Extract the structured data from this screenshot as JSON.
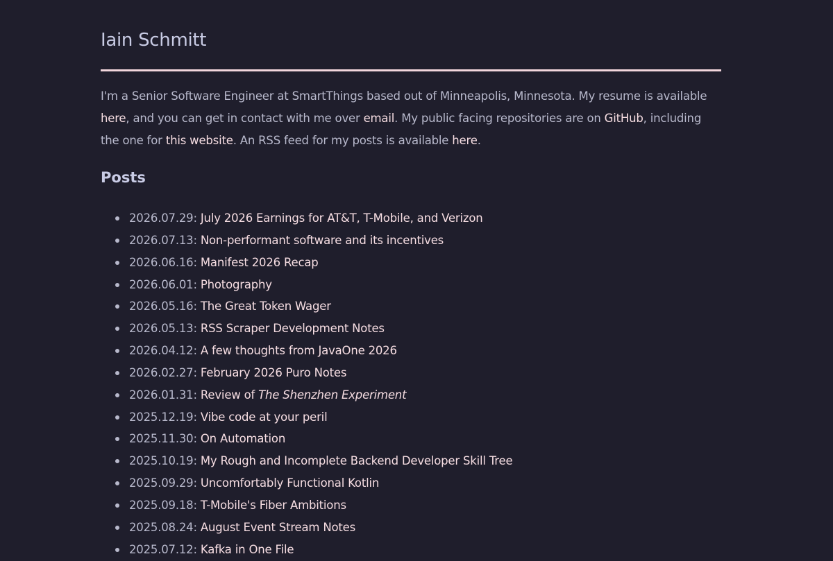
{
  "header": {
    "title": "Iain Schmitt"
  },
  "intro": {
    "t1": "I'm a Senior Software Engineer at SmartThings based out of Minneapolis, Minnesota. My resume is available ",
    "resume_link": "here",
    "t2": ", and you can get in contact with me over ",
    "email_link": "email",
    "t3": ". My public facing repositories are on ",
    "github_link": "GitHub",
    "t4": ", including the one for ",
    "website_link": "this website",
    "t5": ". An RSS feed for my posts is available ",
    "rss_link": "here",
    "t6": "."
  },
  "posts": {
    "heading": "Posts",
    "items": [
      {
        "date": "2026.07.29",
        "title": "July 2026 Earnings for AT&T, T-Mobile, and Verizon"
      },
      {
        "date": "2026.07.13",
        "title": "Non-performant software and its incentives"
      },
      {
        "date": "2026.06.16",
        "title": "Manifest 2026 Recap"
      },
      {
        "date": "2026.06.01",
        "title": "Photography"
      },
      {
        "date": "2026.05.16",
        "title": "The Great Token Wager"
      },
      {
        "date": "2026.05.13",
        "title": "RSS Scraper Development Notes"
      },
      {
        "date": "2026.04.12",
        "title": "A few thoughts from JavaOne 2026"
      },
      {
        "date": "2026.02.27",
        "title": "February 2026 Puro Notes"
      },
      {
        "date": "2026.01.31",
        "title_prefix": "Review of ",
        "title_em": "The Shenzhen Experiment"
      },
      {
        "date": "2025.12.19",
        "title": "Vibe code at your peril"
      },
      {
        "date": "2025.11.30",
        "title": "On Automation"
      },
      {
        "date": "2025.10.19",
        "title": "My Rough and Incomplete Backend Developer Skill Tree"
      },
      {
        "date": "2025.09.29",
        "title": "Uncomfortably Functional Kotlin"
      },
      {
        "date": "2025.09.18",
        "title": "T-Mobile's Fiber Ambitions"
      },
      {
        "date": "2025.08.24",
        "title": "August Event Stream Notes"
      },
      {
        "date": "2025.07.12",
        "title": "Kafka in One File"
      }
    ]
  },
  "colors": {
    "background": "#1f1e2c",
    "text": "#b8b9cc",
    "link": "#f6dde2",
    "rule": "#f2d6dc"
  }
}
